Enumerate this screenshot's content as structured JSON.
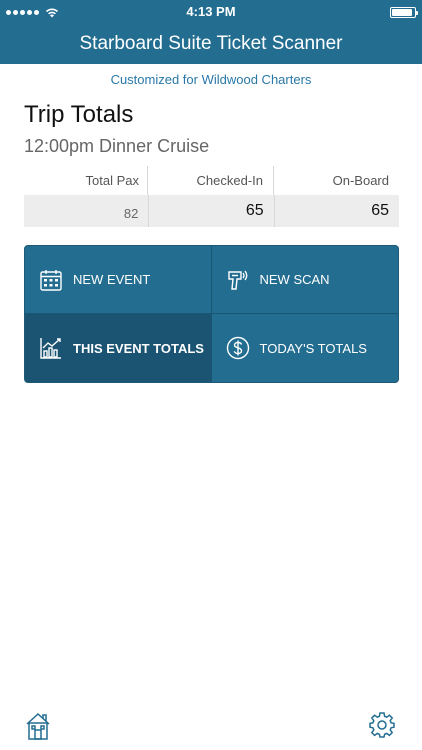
{
  "status_bar": {
    "time": "4:13 PM",
    "battery_level": 0.9
  },
  "nav": {
    "title": "Starboard Suite Ticket Scanner"
  },
  "subtitle": "Customized for Wildwood Charters",
  "section_title": "Trip Totals",
  "event_name": "12:00pm Dinner Cruise",
  "totals": {
    "headers": [
      "Total Pax",
      "Checked-In",
      "On-Board"
    ],
    "values": [
      "82",
      "65",
      "65"
    ]
  },
  "actions": [
    {
      "label": "NEW EVENT",
      "icon": "calendar-icon"
    },
    {
      "label": "NEW SCAN",
      "icon": "scanner-icon"
    },
    {
      "label": "THIS EVENT TOTALS",
      "icon": "chart-icon"
    },
    {
      "label": "TODAY'S TOTALS",
      "icon": "dollar-icon"
    }
  ],
  "toolbar": {
    "home_icon": "home-icon",
    "settings_icon": "gear-icon"
  },
  "colors": {
    "brand": "#236d91",
    "active": "#1b5473",
    "link": "#2a78a8"
  }
}
